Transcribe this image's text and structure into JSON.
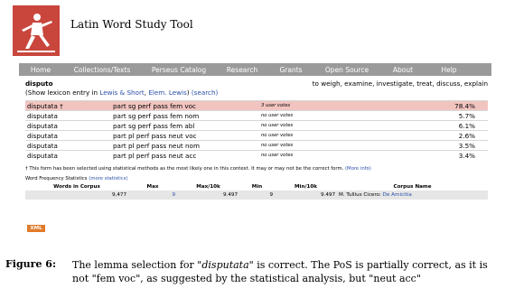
{
  "header": {
    "app_title": "Latin Word Study Tool"
  },
  "nav": [
    "Home",
    "Collections/Texts",
    "Perseus Catalog",
    "Research",
    "Grants",
    "Open Source",
    "About",
    "Help"
  ],
  "lemma": {
    "word": "disputo",
    "definition": "to weigh, examine, investigate, treat, discuss, explain",
    "show_prefix": "(Show lexicon entry in ",
    "lexicon_link": "Lewis & Short",
    "elem_link": "Elem. Lewis",
    "search_link": "(search)"
  },
  "parses": [
    {
      "form": "disputata †",
      "parse": "part sg perf pass fem voc",
      "votes": "3 user votes",
      "pct": "78.4%",
      "selected": true
    },
    {
      "form": "disputata",
      "parse": "part sg perf pass fem nom",
      "votes": "no user votes",
      "pct": "5.7%"
    },
    {
      "form": "disputata",
      "parse": "part sg perf pass fem abl",
      "votes": "no user votes",
      "pct": "6.1%"
    },
    {
      "form": "disputata",
      "parse": "part pl perf pass neut voc",
      "votes": "no user votes",
      "pct": "2.6%"
    },
    {
      "form": "disputata",
      "parse": "part pl perf pass neut nom",
      "votes": "no user votes",
      "pct": "3.5%"
    },
    {
      "form": "disputata",
      "parse": "part pl perf pass neut acc",
      "votes": "no user votes",
      "pct": "3.4%"
    }
  ],
  "note": {
    "text": "† This form has been selected using statistical methods as the most likely one in this context. It may or may not be the correct form.",
    "more_info": "(More info)"
  },
  "freq": {
    "title": "Word Frequency Statistics",
    "more_link": "(more statistics)",
    "headers": [
      "Words in Corpus",
      "Max",
      "Max/10k",
      "Min",
      "Min/10k",
      "Corpus Name"
    ],
    "row": [
      "9,477",
      "9",
      "9.497",
      "9",
      "9.497",
      "M. Tullius Cicero: ",
      "De Amicitia"
    ]
  },
  "xml_badge": "XML",
  "caption": {
    "label": "Figure 6:",
    "pre": "The lemma selection for \"",
    "word": "disputata",
    "post": "\" is correct. The PoS is partially correct, as it is not \"fem voc\", as suggested by the statistical analysis, but \"neut acc\""
  }
}
